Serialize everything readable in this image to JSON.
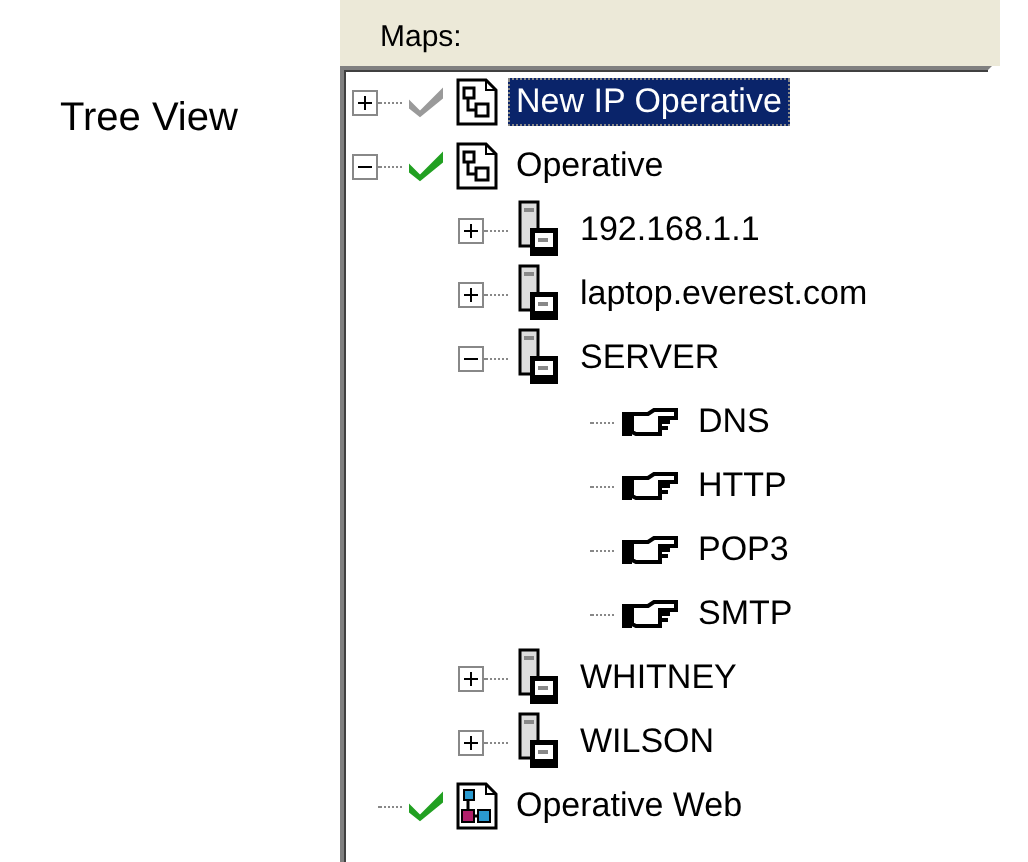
{
  "caption": "Tree View",
  "maps": {
    "label": "Maps:",
    "tree": [
      {
        "label": "New IP Operative",
        "kind": "map",
        "enabled": false,
        "expanded": false,
        "selected": true
      },
      {
        "label": "Operative",
        "kind": "map",
        "enabled": true,
        "expanded": true,
        "selected": false,
        "children": [
          {
            "label": "192.168.1.1",
            "kind": "host",
            "expanded": false,
            "selected": false
          },
          {
            "label": "laptop.everest.com",
            "kind": "host",
            "expanded": false,
            "selected": false
          },
          {
            "label": "SERVER",
            "kind": "host",
            "expanded": true,
            "selected": false,
            "children": [
              {
                "label": "DNS",
                "kind": "service",
                "selected": false
              },
              {
                "label": "HTTP",
                "kind": "service",
                "selected": false
              },
              {
                "label": "POP3",
                "kind": "service",
                "selected": false
              },
              {
                "label": "SMTP",
                "kind": "service",
                "selected": false
              }
            ]
          },
          {
            "label": "WHITNEY",
            "kind": "host",
            "expanded": false,
            "selected": false
          },
          {
            "label": "WILSON",
            "kind": "host",
            "expanded": false,
            "selected": false
          }
        ]
      },
      {
        "label": "Operative Web",
        "kind": "web-map",
        "enabled": true,
        "selected": false
      }
    ]
  }
}
